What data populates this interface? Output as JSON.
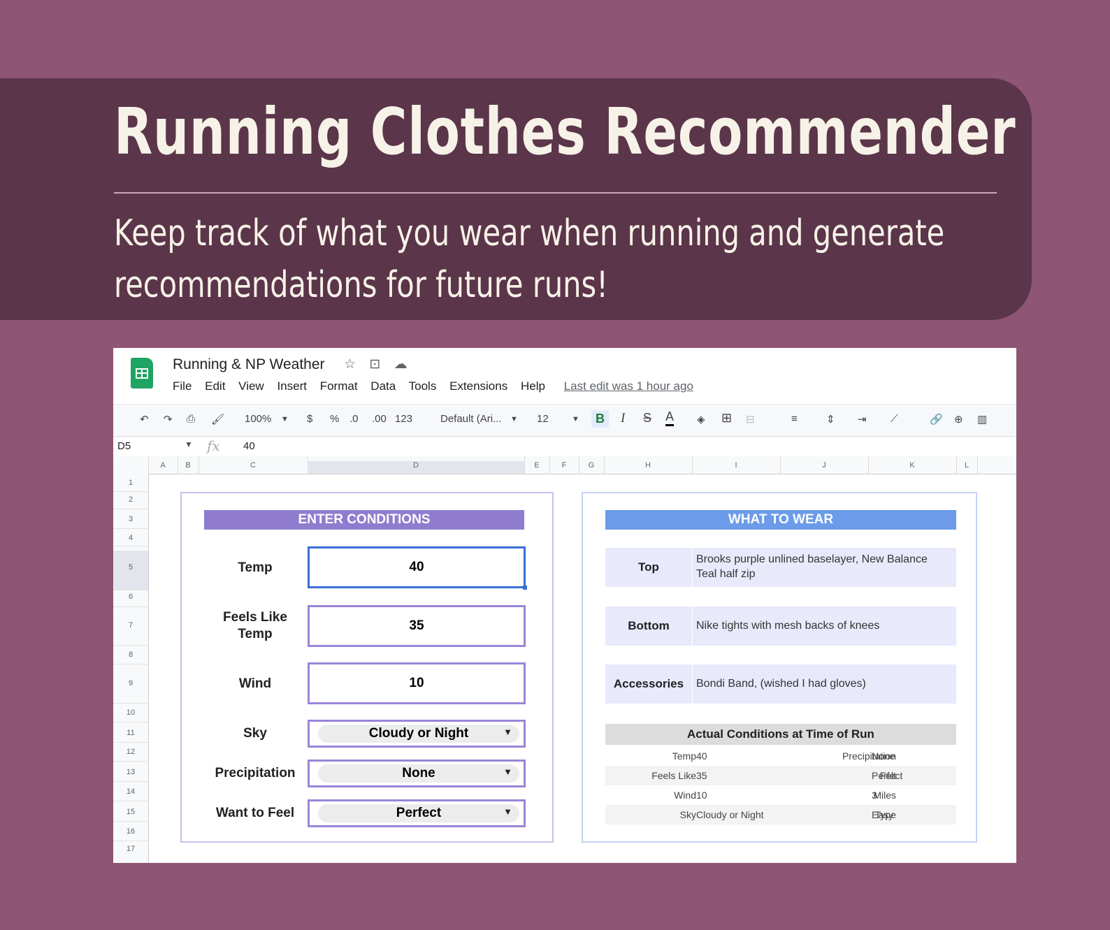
{
  "banner": {
    "title": "Running Clothes Recommender",
    "subtitle_line1": "Keep track of what you wear when running and generate",
    "subtitle_line2": "recommendations for future runs!"
  },
  "sheet": {
    "doc_title": "Running & NP Weather",
    "menu": [
      "File",
      "Edit",
      "View",
      "Insert",
      "Format",
      "Data",
      "Tools",
      "Extensions",
      "Help"
    ],
    "last_edit": "Last edit was 1 hour ago",
    "toolbar": {
      "zoom": "100%",
      "currency": "$",
      "percent": "%",
      "dec_less": ".0",
      "dec_more": ".00",
      "format_more": "123",
      "font": "Default (Ari...",
      "font_size": "12",
      "bold": "B",
      "italic": "I",
      "strike": "S",
      "text_color": "A"
    },
    "formula_bar": {
      "cell": "D5",
      "fx": "fx",
      "value": "40"
    },
    "columns": [
      "A",
      "B",
      "C",
      "D",
      "E",
      "F",
      "G",
      "H",
      "I",
      "J",
      "K",
      "L"
    ],
    "rows": [
      "1",
      "2",
      "3",
      "4",
      "5",
      "6",
      "7",
      "8",
      "9",
      "10",
      "11",
      "12",
      "13",
      "14",
      "15",
      "16",
      "17"
    ]
  },
  "enter_conditions": {
    "header": "ENTER CONDITIONS",
    "temp": {
      "label": "Temp",
      "value": "40"
    },
    "feels_like": {
      "label_line1": "Feels Like",
      "label_line2": "Temp",
      "value": "35"
    },
    "wind": {
      "label": "Wind",
      "value": "10"
    },
    "sky": {
      "label": "Sky",
      "value": "Cloudy or Night"
    },
    "precipitation": {
      "label": "Precipitation",
      "value": "None"
    },
    "want_to_feel": {
      "label": "Want to Feel",
      "value": "Perfect"
    }
  },
  "what_to_wear": {
    "header": "WHAT TO WEAR",
    "top": {
      "label": "Top",
      "value_line1": "Brooks purple unlined baselayer, New Balance",
      "value_line2": "Teal half zip"
    },
    "bottom": {
      "label": "Bottom",
      "value": "Nike tights with mesh backs of knees"
    },
    "accessories": {
      "label": "Accessories",
      "value": "Bondi Band, (wished I had gloves)"
    },
    "actual_conditions": {
      "header": "Actual Conditions at Time of Run",
      "rows": [
        {
          "k1": "Temp",
          "v1": "40",
          "k2": "Precipitation",
          "v2": "None"
        },
        {
          "k1": "Feels Like",
          "v1": "35",
          "k2": "Felt",
          "v2": "Perfect"
        },
        {
          "k1": "Wind",
          "v1": "10",
          "k2": "Miles",
          "v2": "3"
        },
        {
          "k1": "Sky",
          "v1": "Cloudy or Night",
          "k2": "Type",
          "v2": "Easy"
        }
      ]
    }
  },
  "colors": {
    "background": "#8e5574",
    "banner": "#5b3549",
    "enter_header": "#8f7ccf",
    "wear_header": "#6b9be9",
    "sheets_green": "#1fa463"
  }
}
